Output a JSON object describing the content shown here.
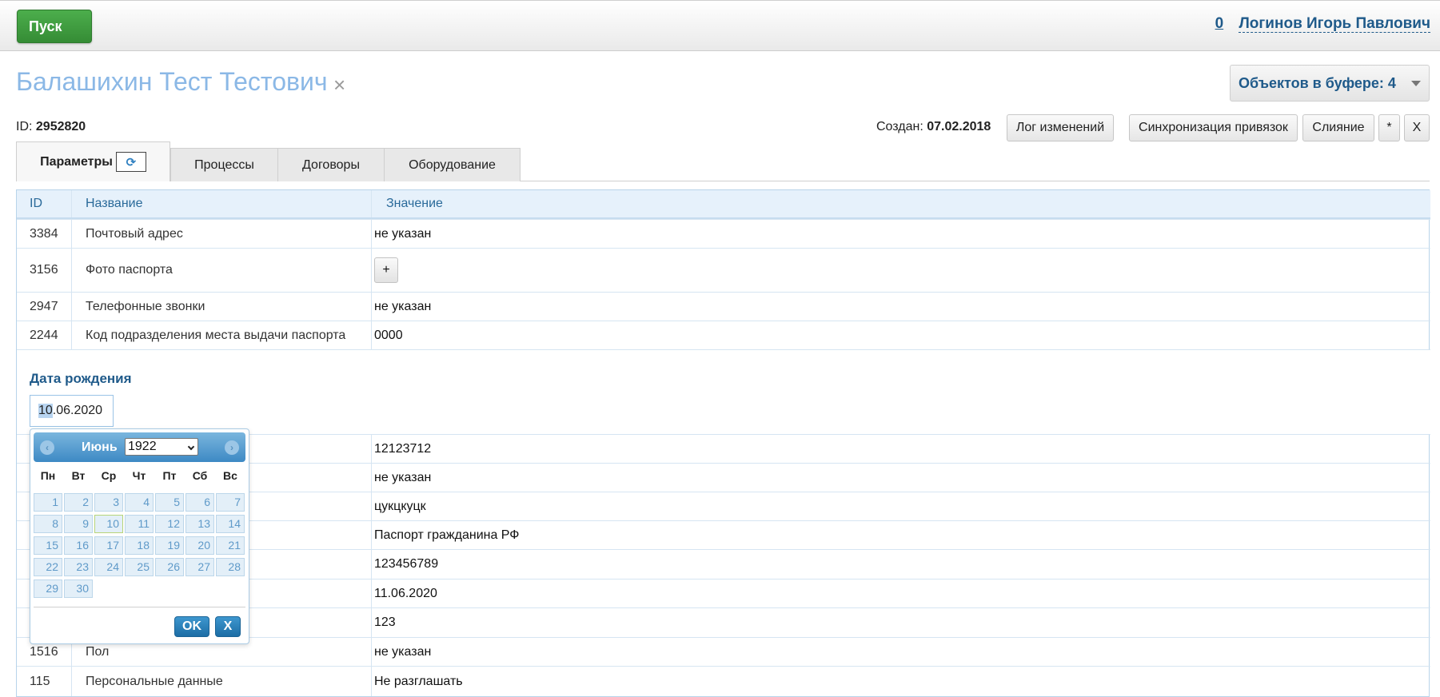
{
  "header": {
    "start_label": "Пуск",
    "counter": "0",
    "user_name": "Логинов Игорь Павлович"
  },
  "page": {
    "title": "Балашихин Тест Тестович",
    "close_glyph": "×",
    "buffer_label": "Объектов в буфере: 4",
    "id_label": "ID:",
    "id_value": "2952820",
    "created_label": "Создан:",
    "created_value": "07.02.2018",
    "toolbar": {
      "log": "Лог изменений",
      "sync": "Синхронизация привязок",
      "merge": "Слияние",
      "star": "*",
      "close": "X"
    }
  },
  "tabs": [
    {
      "label": "Параметры"
    },
    {
      "label": "Процессы"
    },
    {
      "label": "Договоры"
    },
    {
      "label": "Оборудование"
    }
  ],
  "refresh_glyph": "⟳",
  "table": {
    "headers": {
      "id": "ID",
      "name": "Название",
      "value": "Значение"
    },
    "rows": [
      {
        "id": "3384",
        "name": "Почтовый адрес",
        "value": "не указан"
      },
      {
        "id": "3156",
        "name": "Фото паспорта",
        "value": "+"
      },
      {
        "id": "2947",
        "name": "Телефонные звонки",
        "value": "не указан"
      },
      {
        "id": "2244",
        "name": "Код подразделения места выдачи паспорта",
        "value": "0000"
      },
      {
        "id": "",
        "name": "",
        "value": "12123712"
      },
      {
        "id": "",
        "name": "",
        "value": "не указан"
      },
      {
        "id": "",
        "name": "",
        "value": "цукцкуцк"
      },
      {
        "id": "",
        "name": "",
        "value": "Паспорт гражданина РФ"
      },
      {
        "id": "",
        "name": "",
        "value": "123456789"
      },
      {
        "id": "",
        "name": "",
        "value": "11.06.2020"
      },
      {
        "id": "",
        "name": "",
        "value": "123"
      },
      {
        "id": "1516",
        "name": "Пол",
        "value": "не указан"
      },
      {
        "id": "115",
        "name": "Персональные данные",
        "value": "Не разглашать"
      }
    ]
  },
  "date_editor": {
    "label": "Дата рождения",
    "value_selected": "10",
    "value_rest": ".06.2020"
  },
  "calendar": {
    "prev_glyph": "‹",
    "next_glyph": "›",
    "month": "Июнь",
    "year": "1922",
    "weekdays": [
      "Пн",
      "Вт",
      "Ср",
      "Чт",
      "Пт",
      "Сб",
      "Вс"
    ],
    "days": [
      "1",
      "2",
      "3",
      "4",
      "5",
      "6",
      "7",
      "8",
      "9",
      "10",
      "11",
      "12",
      "13",
      "14",
      "15",
      "16",
      "17",
      "18",
      "19",
      "20",
      "21",
      "22",
      "23",
      "24",
      "25",
      "26",
      "27",
      "28",
      "29",
      "30"
    ],
    "ok_label": "OK",
    "cancel_label": "X"
  }
}
